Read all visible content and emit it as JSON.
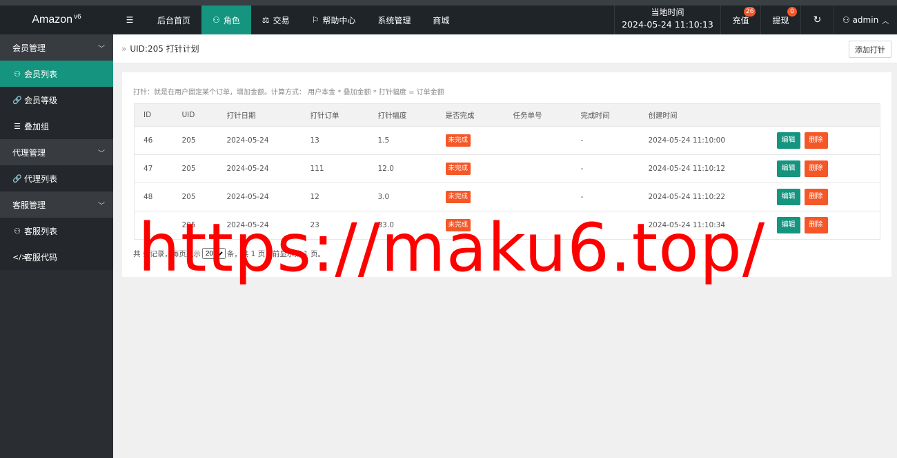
{
  "app": {
    "name": "Amazon",
    "version": "v6"
  },
  "nav": {
    "menu_icon": "menu-icon",
    "items": [
      {
        "label": "后台首页",
        "icon": ""
      },
      {
        "label": "角色",
        "icon": "user-icon",
        "active": true
      },
      {
        "label": "交易",
        "icon": "scale-icon"
      },
      {
        "label": "帮助中心",
        "icon": "flag-icon"
      },
      {
        "label": "系统管理",
        "icon": ""
      },
      {
        "label": "商城",
        "icon": ""
      }
    ]
  },
  "header_right": {
    "time_label": "当地时间",
    "time_value": "2024-05-24 11:10:13",
    "recharge_label": "充值",
    "recharge_badge": "26",
    "withdraw_label": "提现",
    "withdraw_badge": "0",
    "refresh_icon": "refresh-icon",
    "user_label": "admin"
  },
  "sidebar": {
    "groups": [
      {
        "label": "会员管理",
        "items": [
          {
            "label": "会员列表",
            "icon": "user-icon",
            "active": true
          },
          {
            "label": "会员等级",
            "icon": "link-icon"
          },
          {
            "label": "叠加组",
            "icon": "list-icon"
          }
        ]
      },
      {
        "label": "代理管理",
        "items": [
          {
            "label": "代理列表",
            "icon": "link-icon"
          }
        ]
      },
      {
        "label": "客服管理",
        "items": [
          {
            "label": "客服列表",
            "icon": "users-icon"
          },
          {
            "label": "客服代码",
            "icon": "code-icon"
          }
        ]
      }
    ]
  },
  "breadcrumb": {
    "title": "UID:205 打针计划",
    "add_button": "添加打针"
  },
  "description": "打针：就是在用户固定某个订单，增加金额。计算方式： 用户本金 * 叠加金额 * 打针幅度 = 订单金额",
  "table": {
    "headers": [
      "ID",
      "UID",
      "打针日期",
      "打针订单",
      "打针幅度",
      "是否完成",
      "任务单号",
      "完成时间",
      "创建时间",
      ""
    ],
    "rows": [
      {
        "id": "46",
        "uid": "205",
        "date": "2024-05-24",
        "order": "13",
        "range": "1.5",
        "status": "未完成",
        "task_no": "",
        "done_time": "-",
        "created": "2024-05-24 11:10:00"
      },
      {
        "id": "47",
        "uid": "205",
        "date": "2024-05-24",
        "order": "111",
        "range": "12.0",
        "status": "未完成",
        "task_no": "",
        "done_time": "-",
        "created": "2024-05-24 11:10:12"
      },
      {
        "id": "48",
        "uid": "205",
        "date": "2024-05-24",
        "order": "12",
        "range": "3.0",
        "status": "未完成",
        "task_no": "",
        "done_time": "-",
        "created": "2024-05-24 11:10:22"
      },
      {
        "id": "",
        "uid": "205",
        "date": "2024-05-24",
        "order": "23",
        "range": "33.0",
        "status": "未完成",
        "task_no": "",
        "done_time": "-",
        "created": "2024-05-24 11:10:34"
      }
    ],
    "edit_label": "编辑",
    "delete_label": "删除"
  },
  "pager": {
    "prefix": "共",
    "mid1": "条记录，每页显示",
    "per_page": "20",
    "mid2": "条，共 1 页当前显示第 1 页。"
  },
  "watermark": "https://maku6.top/"
}
